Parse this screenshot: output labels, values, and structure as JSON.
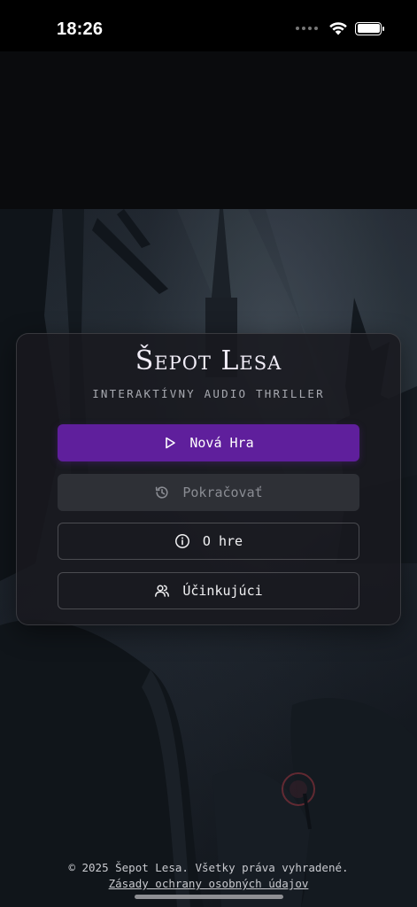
{
  "status_bar": {
    "time": "18:26",
    "icons": [
      "cellular-dots-icon",
      "wifi-icon",
      "battery-icon"
    ],
    "battery_level": 1.0
  },
  "game": {
    "title": "Šepot Lesa",
    "subtitle": "INTERAKTÍVNY AUDIO THRILLER"
  },
  "menu": {
    "new_game": {
      "label": "Nová Hra",
      "icon": "play-icon"
    },
    "continue": {
      "label": "Pokračovať",
      "icon": "history-icon",
      "enabled": false
    },
    "about": {
      "label": "O hre",
      "icon": "info-icon"
    },
    "credits": {
      "label": "Účinkujúci",
      "icon": "users-icon"
    }
  },
  "footer": {
    "copyright": "© 2025 Šepot Lesa. Všetky práva vyhradené.",
    "privacy_link": "Zásady ochrany osobných údajov"
  },
  "colors": {
    "accent": "#5f1f9c",
    "card_bg": "#18191e",
    "disabled_bg": "#2e3036",
    "background": "#0a0b0d"
  }
}
